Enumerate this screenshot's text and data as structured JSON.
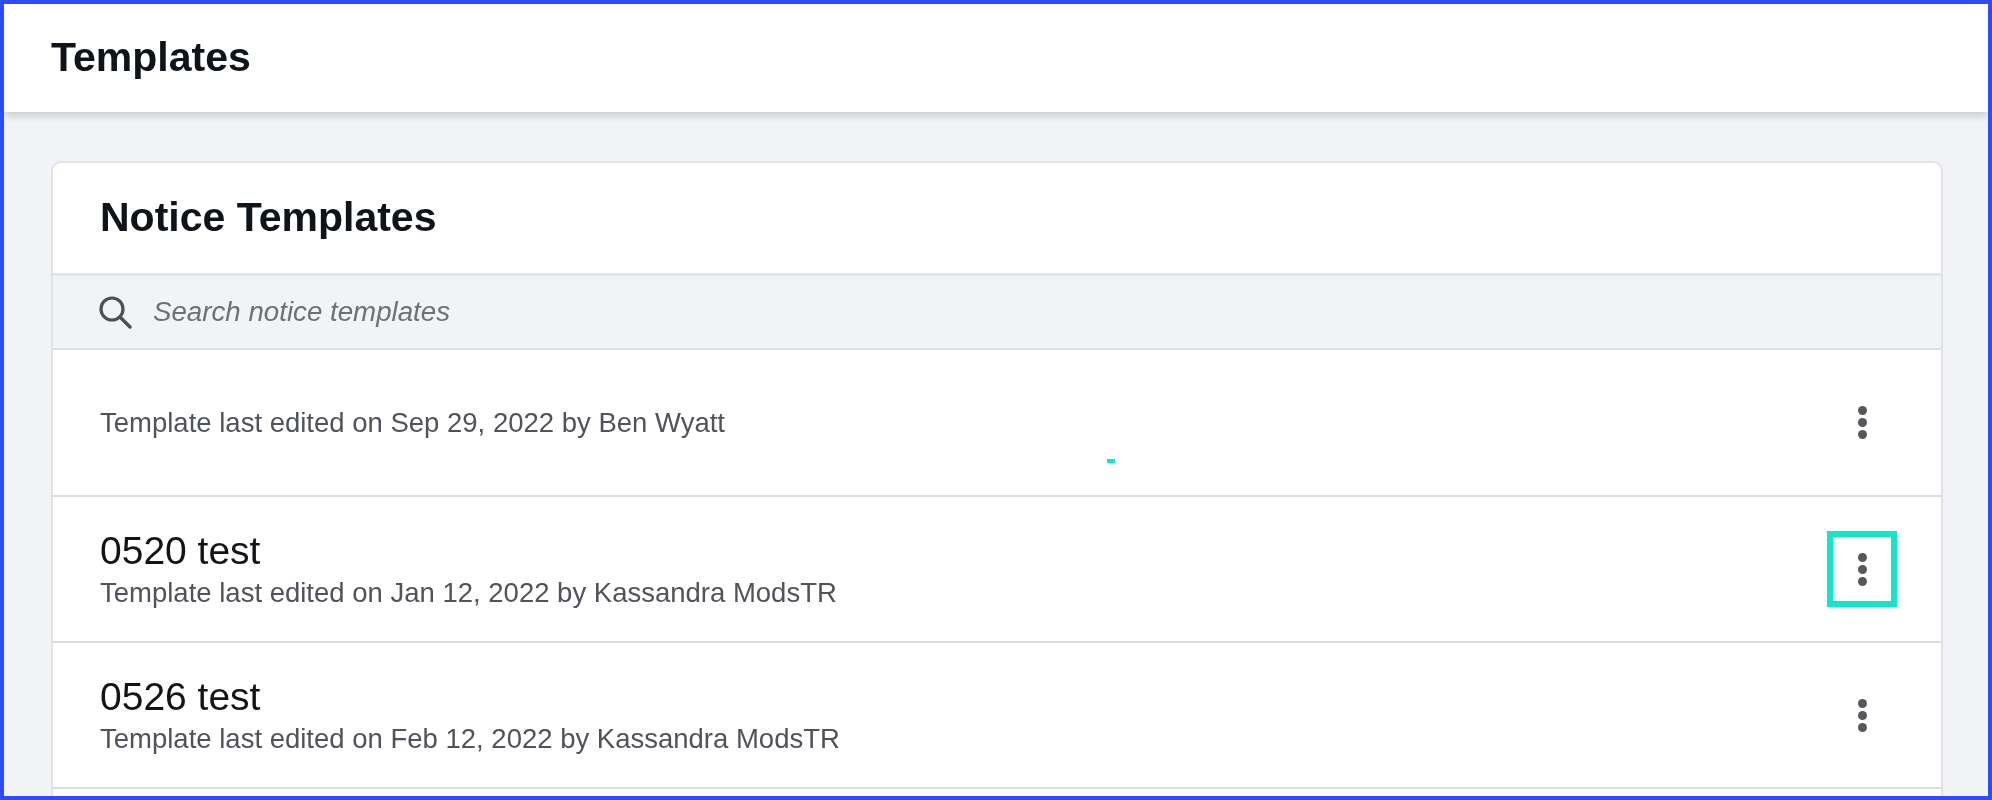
{
  "page": {
    "title": "Templates"
  },
  "card": {
    "title": "Notice Templates",
    "search": {
      "placeholder": "Search notice templates"
    },
    "rows": [
      {
        "subtitle": "Template last edited on Sep 29, 2022 by Ben Wyatt",
        "highlighted": false
      },
      {
        "title": "0520 test",
        "subtitle": "Template last edited on Jan 12, 2022 by Kassandra ModsTR",
        "highlighted": true
      },
      {
        "title": "0526 test",
        "subtitle": "Template last edited on Feb 12, 2022 by Kassandra ModsTR",
        "highlighted": false
      }
    ]
  }
}
